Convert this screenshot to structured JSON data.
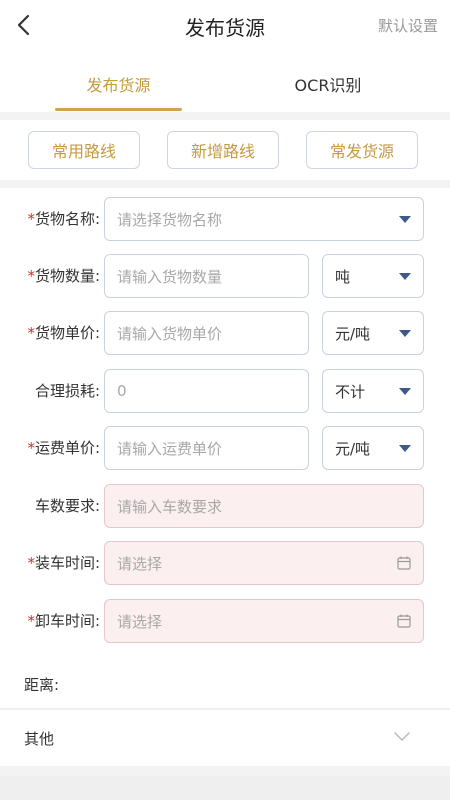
{
  "header": {
    "title": "发布货源",
    "default_settings": "默认设置"
  },
  "tabs": [
    {
      "label": "发布货源",
      "active": true
    },
    {
      "label": "OCR识别",
      "active": false
    }
  ],
  "quick_buttons": [
    {
      "label": "常用路线"
    },
    {
      "label": "新增路线"
    },
    {
      "label": "常发货源"
    }
  ],
  "form": {
    "goods_name": {
      "label": "货物名称:",
      "required": true,
      "placeholder": "请选择货物名称",
      "icon": "caret-down-icon"
    },
    "goods_qty": {
      "label": "货物数量:",
      "required": true,
      "placeholder": "请输入货物数量",
      "unit": "吨"
    },
    "goods_price": {
      "label": "货物单价:",
      "required": true,
      "placeholder": "请输入货物单价",
      "unit": "元/吨"
    },
    "loss": {
      "label": "合理损耗:",
      "required": false,
      "value": "0",
      "unit": "不计"
    },
    "freight_price": {
      "label": "运费单价:",
      "required": true,
      "placeholder": "请输入运费单价",
      "unit": "元/吨"
    },
    "truck_count": {
      "label": "车数要求:",
      "required": false,
      "placeholder": "请输入车数要求"
    },
    "load_time": {
      "label": "装车时间:",
      "required": true,
      "placeholder": "请选择",
      "icon": "calendar-icon"
    },
    "unload_time": {
      "label": "卸车时间:",
      "required": true,
      "placeholder": "请选择",
      "icon": "calendar-icon"
    },
    "distance_label": "距离:"
  },
  "other": {
    "label": "其他"
  },
  "colors": {
    "accent": "#c69a40",
    "required_star": "#c0392b",
    "caret": "#3f5a8a",
    "pink_field": "#fbeff0"
  }
}
